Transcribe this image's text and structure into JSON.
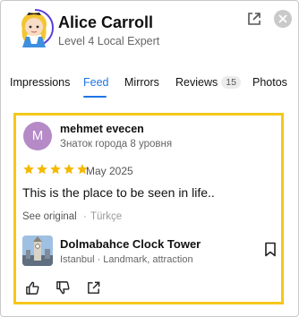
{
  "header": {
    "user_name": "Alice Carroll",
    "user_level": "Level 4 Local Expert",
    "avatar_icon": "cartoon-girl-avatar-icon",
    "open_icon": "open-external-icon",
    "close_icon": "close-icon",
    "accent_ring": "#5b3fd9"
  },
  "tabs": [
    {
      "label": "Impressions",
      "active": false
    },
    {
      "label": "Feed",
      "active": true
    },
    {
      "label": "Mirrors",
      "active": false
    },
    {
      "label": "Reviews",
      "active": false,
      "badge": "15"
    },
    {
      "label": "Photos",
      "active": false
    }
  ],
  "review": {
    "avatar_letter": "M",
    "avatar_color": "#b58ac7",
    "author": "mehmet evecen",
    "author_subtitle": "Знаток города 8 уровня",
    "rating": 5,
    "rating_max": 5,
    "date": "May 2025",
    "text": "This is the place to be seen in life..",
    "see_original": "See original",
    "separator": "·",
    "language": "Türkçe",
    "place": {
      "name": "Dolmabahce Clock Tower",
      "meta": "Istanbul · Landmark, attraction",
      "bookmark_icon": "bookmark-icon"
    },
    "actions": [
      "like-icon",
      "dislike-icon",
      "share-icon"
    ]
  },
  "colors": {
    "accent": "#1e74e6",
    "highlight_border": "#f6c71a",
    "star": "#f5b800"
  }
}
